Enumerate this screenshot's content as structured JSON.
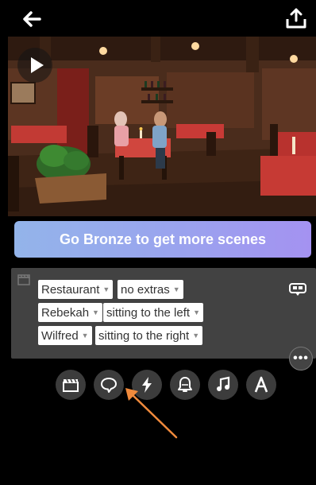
{
  "banner": {
    "label": "Go Bronze to get more scenes"
  },
  "scene_rows": [
    {
      "primary": "Restaurant",
      "secondary": "no extras"
    },
    {
      "primary": "Rebekah",
      "secondary": "sitting to the left"
    },
    {
      "primary": "Wilfred",
      "secondary": "sitting to the right"
    }
  ],
  "more": {
    "label": "•••"
  },
  "toolbar": {
    "icons": [
      "clapperboard-icon",
      "speech-bubble-icon",
      "lightning-icon",
      "bell-icon",
      "music-note-icon",
      "text-a-icon"
    ]
  },
  "colors": {
    "background": "#000000",
    "panel": "#424242",
    "banner_start": "#93b4ea",
    "banner_end": "#a492f1",
    "annotation_arrow": "#f08a3c"
  }
}
